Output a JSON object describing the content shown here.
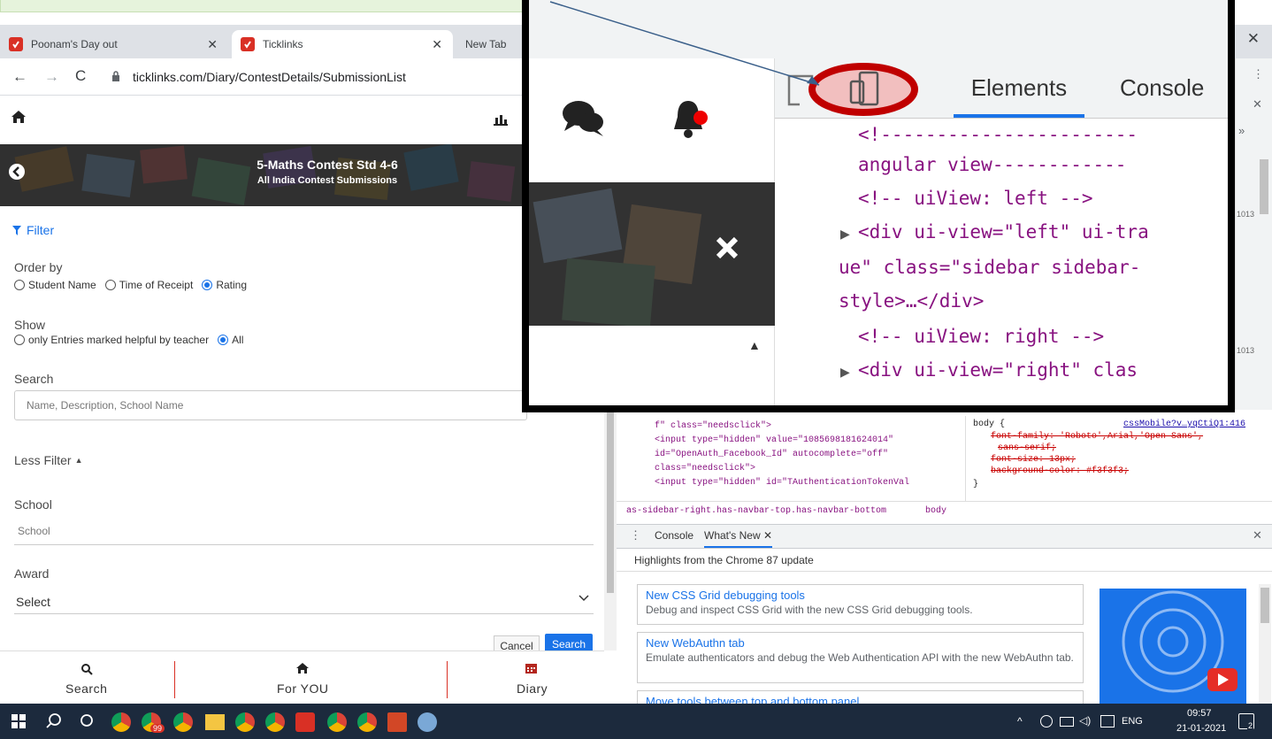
{
  "browser": {
    "tabs": [
      {
        "title": "Poonam's Day out",
        "active": false
      },
      {
        "title": "Ticklinks",
        "active": true
      },
      {
        "title": "New Tab",
        "active": false
      }
    ],
    "url": "ticklinks.com/Diary/ContestDetails/SubmissionList"
  },
  "app": {
    "banner_title": "5-Maths Contest Std 4-6",
    "banner_subtitle": "All India Contest Submissions",
    "filter_label": "Filter",
    "order_by": {
      "label": "Order by",
      "options": [
        "Student Name",
        "Time of Receipt",
        "Rating"
      ],
      "selected": "Rating"
    },
    "show": {
      "label": "Show",
      "options": [
        "only Entries marked helpful by teacher",
        "All"
      ],
      "selected": "All"
    },
    "search": {
      "label": "Search",
      "placeholder": "Name, Description, School Name"
    },
    "less_filter": "Less Filter",
    "school": {
      "label": "School",
      "placeholder": "School"
    },
    "award": {
      "label": "Award",
      "value": "Select"
    },
    "cancel_label": "Cancel",
    "search_button": "Search",
    "bottom_nav": [
      "Search",
      "For YOU",
      "Diary"
    ]
  },
  "devtools": {
    "tabs": [
      "Elements",
      "Console"
    ],
    "code_lines": [
      "f\" class=\"needsclick\">",
      "<input type=\"hidden\" value=\"1085698181624014\"",
      "id=\"OpenAuth_Facebook_Id\" autocomplete=\"off\"",
      "class=\"needsclick\">",
      "<input type=\"hidden\" id=\"TAuthenticationTokenVal"
    ],
    "breadcrumb": {
      "path": "as-sidebar-right.has-navbar-top.has-navbar-bottom",
      "body": "body"
    },
    "styles": {
      "selector": "body {",
      "source": "cssMobile?v…yqCtiQ1:416",
      "decls": [
        "font-family: 'Roboto',Arial,'Open Sans',",
        "sans-serif;",
        "font-size: 13px;",
        "background-color: #f3f3f3;"
      ],
      "close": "}"
    },
    "line_numbers": [
      "1013",
      "1013"
    ],
    "drawer_tabs": [
      "Console",
      "What's New"
    ],
    "highlights": "Highlights from the Chrome 87 update",
    "features": [
      {
        "title": "New CSS Grid debugging tools",
        "desc": "Debug and inspect CSS Grid with the new CSS Grid debugging tools."
      },
      {
        "title": "New WebAuthn tab",
        "desc": "Emulate authenticators and debug the Web Authentication API with the new WebAuthn tab."
      },
      {
        "title": "Move tools between top and bottom panel",
        "desc": ""
      }
    ]
  },
  "zoom": {
    "tabs": [
      "Elements",
      "Console"
    ],
    "lines": [
      "<!-----------------------",
      "angular view------------",
      "<!-- uiView: left -->",
      "<div ui-view=\"left\" ui-tra",
      "ue\" class=\"sidebar sidebar-",
      "style>…</div>",
      "<!-- uiView: right -->",
      "<div ui-view=\"right\" clas"
    ]
  },
  "taskbar": {
    "time": "09:57",
    "date": "21-01-2021",
    "lang": "ENG",
    "badge": "99",
    "notif": "2"
  },
  "colors": {
    "accent": "#1a73e8",
    "danger": "#d93025",
    "taskbar": "#1c2a3d"
  }
}
